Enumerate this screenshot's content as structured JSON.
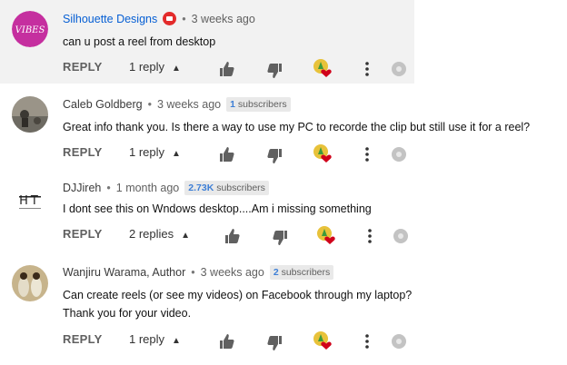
{
  "comments": [
    {
      "author": "Silhouette Designs",
      "time": "3 weeks ago",
      "text": "can u post a reel from desktop",
      "reply_label": "REPLY",
      "replies": "1 reply",
      "avatar_text": "VIBES",
      "has_shop_badge": true
    },
    {
      "author": "Caleb Goldberg",
      "time": "3 weeks ago",
      "subs_count": "1",
      "subs_label": "subscribers",
      "text": "Great info thank you. Is there a way to use my PC to recorde the clip but still use it for a reel?",
      "reply_label": "REPLY",
      "replies": "1 reply"
    },
    {
      "author": "DJJireh",
      "time": "1 month ago",
      "subs_count": "2.73K",
      "subs_label": "subscribers",
      "text": "I dont see this on Wndows desktop....Am i missing something",
      "reply_label": "REPLY",
      "replies": "2 replies",
      "avatar_text": "HT"
    },
    {
      "author": "Wanjiru Warama, Author",
      "time": "3 weeks ago",
      "subs_count": "2",
      "subs_label": "subscribers",
      "text_lines": [
        "Can create reels (or see my videos) on Facebook through my laptop?",
        "Thank you for your video."
      ],
      "reply_label": "REPLY",
      "replies": "1 reply"
    }
  ],
  "icons": {
    "like": "thumbs-up-icon",
    "dislike": "thumbs-down-icon",
    "creator_heart": "creator-heart-icon",
    "more": "more-vert-icon",
    "record": "record-icon",
    "caret": "chevron-up-icon"
  },
  "colors": {
    "highlight_bg": "#f2f2f2",
    "author_link": "#065fd4",
    "subs_count": "#3e7fd6",
    "heart": "#d0021b"
  }
}
